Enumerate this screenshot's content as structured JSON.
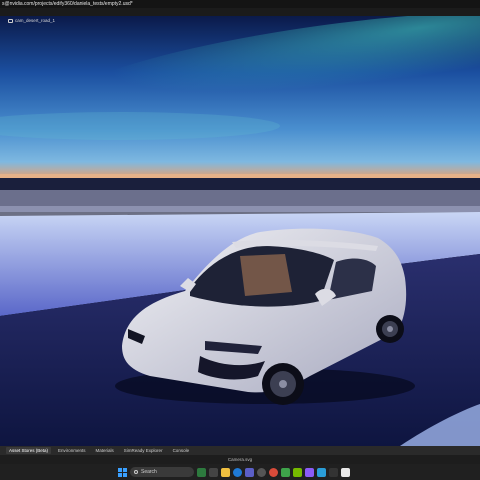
{
  "window": {
    "title": "s@nvidia.com/projects/edify360/daniela_tests/empty2.usd*"
  },
  "viewport": {
    "camera_label": "cam_desert_road_1"
  },
  "bottom_tabs": [
    {
      "label": "Asset Stores (Beta)"
    },
    {
      "label": "Environments"
    },
    {
      "label": "Materials"
    },
    {
      "label": "SimReady Explorer"
    },
    {
      "label": "Console"
    }
  ],
  "statusbar": {
    "text": "Camera.svg"
  },
  "taskbar": {
    "search_placeholder": "Search",
    "icons": [
      "start-icon",
      "search-icon",
      "weather-icon",
      "task-view-icon",
      "file-explorer-icon",
      "edge-icon",
      "teams-icon",
      "settings-icon",
      "chrome-icon",
      "green-app-icon",
      "nvidia-icon",
      "app-icon",
      "photos-icon",
      "terminal-icon",
      "notes-icon"
    ]
  },
  "colors": {
    "titlebar": "#141414",
    "tabs": "#2a2a2a",
    "taskbar": "#202020",
    "accent": "#3aa0ff"
  }
}
